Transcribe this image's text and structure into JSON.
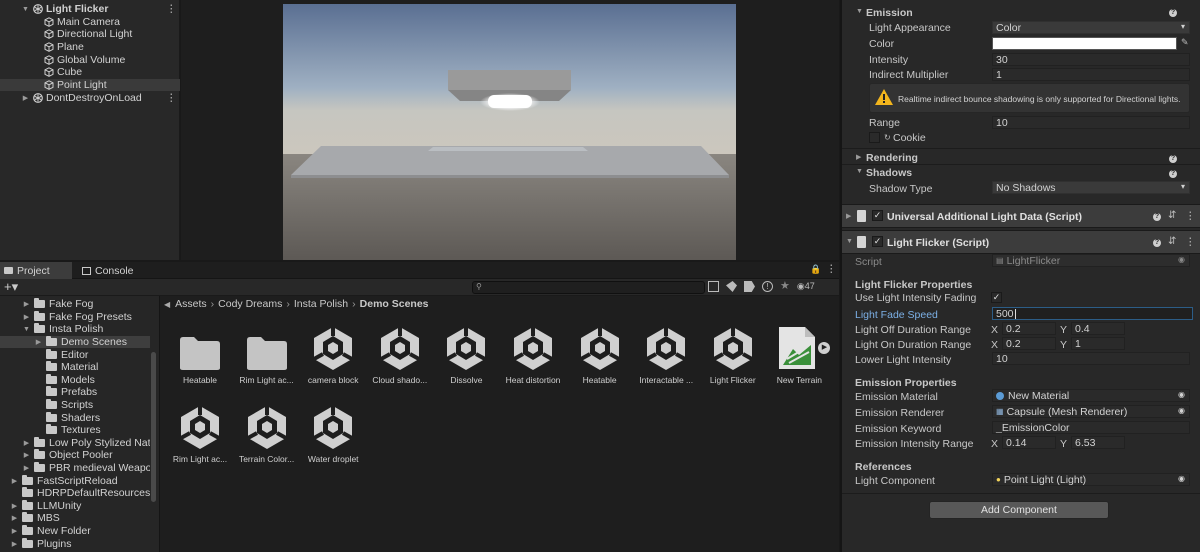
{
  "hierarchy": {
    "scene": "Light Flicker",
    "items": [
      "Main Camera",
      "Directional Light",
      "Plane",
      "Global Volume",
      "Cube",
      "Point Light"
    ],
    "dont_destroy": "DontDestroyOnLoad"
  },
  "project": {
    "tabs": [
      "Project",
      "Console"
    ],
    "breadcrumb": [
      "Assets",
      "Cody Dreams",
      "Insta Polish",
      "Demo Scenes"
    ],
    "visibility_count": "47",
    "tree": [
      {
        "label": "Fake Fog",
        "depth": 2,
        "arrow": "right"
      },
      {
        "label": "Fake Fog Presets",
        "depth": 2,
        "arrow": "right"
      },
      {
        "label": "Insta Polish",
        "depth": 2,
        "arrow": "down"
      },
      {
        "label": "Demo Scenes",
        "depth": 3,
        "arrow": "right",
        "selected": true
      },
      {
        "label": "Editor",
        "depth": 3,
        "arrow": "none"
      },
      {
        "label": "Material",
        "depth": 3,
        "arrow": "none"
      },
      {
        "label": "Models",
        "depth": 3,
        "arrow": "none"
      },
      {
        "label": "Prefabs",
        "depth": 3,
        "arrow": "none"
      },
      {
        "label": "Scripts",
        "depth": 3,
        "arrow": "none"
      },
      {
        "label": "Shaders",
        "depth": 3,
        "arrow": "none"
      },
      {
        "label": "Textures",
        "depth": 3,
        "arrow": "none"
      },
      {
        "label": "Low Poly Stylized Natu",
        "depth": 2,
        "arrow": "right"
      },
      {
        "label": "Object Pooler",
        "depth": 2,
        "arrow": "right"
      },
      {
        "label": "PBR medieval Weapons",
        "depth": 2,
        "arrow": "right"
      },
      {
        "label": "FastScriptReload",
        "depth": 1,
        "arrow": "right"
      },
      {
        "label": "HDRPDefaultResources",
        "depth": 1,
        "arrow": "none"
      },
      {
        "label": "LLMUnity",
        "depth": 1,
        "arrow": "right"
      },
      {
        "label": "MBS",
        "depth": 1,
        "arrow": "right"
      },
      {
        "label": "New Folder",
        "depth": 1,
        "arrow": "right"
      },
      {
        "label": "Plugins",
        "depth": 1,
        "arrow": "right"
      }
    ],
    "assets": [
      {
        "label": "Heatable",
        "icon": "folder-icon"
      },
      {
        "label": "Rim Light ac...",
        "icon": "folder-icon"
      },
      {
        "label": "camera block",
        "icon": "unity-scene-icon"
      },
      {
        "label": "Cloud shado...",
        "icon": "unity-scene-icon"
      },
      {
        "label": "Dissolve",
        "icon": "unity-scene-icon"
      },
      {
        "label": "Heat distortion",
        "icon": "unity-scene-icon"
      },
      {
        "label": "Heatable",
        "icon": "unity-scene-icon"
      },
      {
        "label": "Interactable ...",
        "icon": "unity-scene-icon"
      },
      {
        "label": "Light Flicker",
        "icon": "unity-scene-icon"
      },
      {
        "label": "New Terrain",
        "icon": "terrain-icon"
      },
      {
        "label": "Rim Light ac...",
        "icon": "unity-scene-icon"
      },
      {
        "label": "Terrain Color...",
        "icon": "unity-scene-icon"
      },
      {
        "label": "Water droplet",
        "icon": "unity-scene-icon"
      }
    ]
  },
  "inspector": {
    "emission_header": "Emission",
    "light_appearance_label": "Light Appearance",
    "light_appearance_value": "Color",
    "color_label": "Color",
    "color_value": "#ffffff",
    "intensity_label": "Intensity",
    "intensity_value": "30",
    "indirect_label": "Indirect Multiplier",
    "indirect_value": "1",
    "warning": "Realtime indirect bounce shadowing is only supported for Directional lights.",
    "range_label": "Range",
    "range_value": "10",
    "cookie_label": "Cookie",
    "rendering_header": "Rendering",
    "shadows_header": "Shadows",
    "shadow_type_label": "Shadow Type",
    "shadow_type_value": "No Shadows",
    "uald_title": "Universal Additional Light Data (Script)",
    "lf_title": "Light Flicker (Script)",
    "script_label": "Script",
    "script_value": "LightFlicker",
    "lfp_header": "Light Flicker Properties",
    "use_fading_label": "Use Light Intensity Fading",
    "fade_speed_label": "Light Fade Speed",
    "fade_speed_value": "500",
    "off_duration_label": "Light Off Duration Range",
    "off_x": "0.2",
    "off_y": "0.4",
    "on_duration_label": "Light On Duration Range",
    "on_x": "0.2",
    "on_y": "1",
    "lower_label": "Lower Light Intensity",
    "lower_value": "10",
    "ep_header": "Emission Properties",
    "em_material_label": "Emission Material",
    "em_material_value": "New Material",
    "em_renderer_label": "Emission Renderer",
    "em_renderer_value": "Capsule (Mesh Renderer)",
    "em_keyword_label": "Emission Keyword",
    "em_keyword_value": "_EmissionColor",
    "em_range_label": "Emission Intensity Range",
    "em_x": "0.14",
    "em_y": "6.53",
    "refs_header": "References",
    "light_comp_label": "Light Component",
    "light_comp_value": "Point Light (Light)",
    "add_component": "Add Component",
    "x_letter": "X",
    "y_letter": "Y"
  },
  "colors": {
    "selection_field": "#2c5d87",
    "accent_label": "#7cb0e6",
    "warning": "#f2b51d"
  }
}
